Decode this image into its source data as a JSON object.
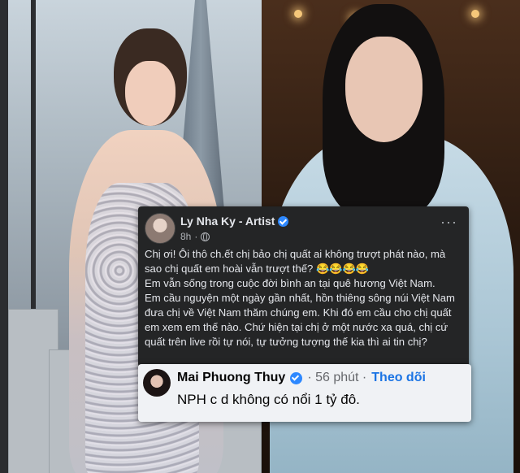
{
  "post": {
    "author": "Ly Nha Ky - Artist",
    "time": "8h",
    "more_label": "···",
    "lines": [
      "Chị ơi! Ôi thô ch.ết chị bảo chị quất ai không trượt phát nào, mà sao chị quất em hoài vẫn trượt thế? 😂😂😂😂",
      "Em vẫn sống trong cuộc đời bình an tại quê hương Việt Nam.",
      "Em cầu nguyện một ngày gần nhất, hồn thiêng sông núi Việt Nam đưa chị về Việt Nam thăm chúng em. Khi đó em cầu cho chị quất em xem em thế nào. Chứ hiện tại chị ở một nước xa quá, chị cứ quất trên live rồi tự nói, tự tưởng tượng thế kia thì ai tin chị?"
    ]
  },
  "comment": {
    "author": "Mai Phuong Thuy",
    "time": "· 56 phút ·",
    "follow_label": "Theo dõi",
    "text": "NPH c d không có nổi 1 tỷ đô."
  },
  "colors": {
    "post_bg": "#242526",
    "comment_bg": "#f0f2f5",
    "accent_blue": "#1b74e4"
  }
}
